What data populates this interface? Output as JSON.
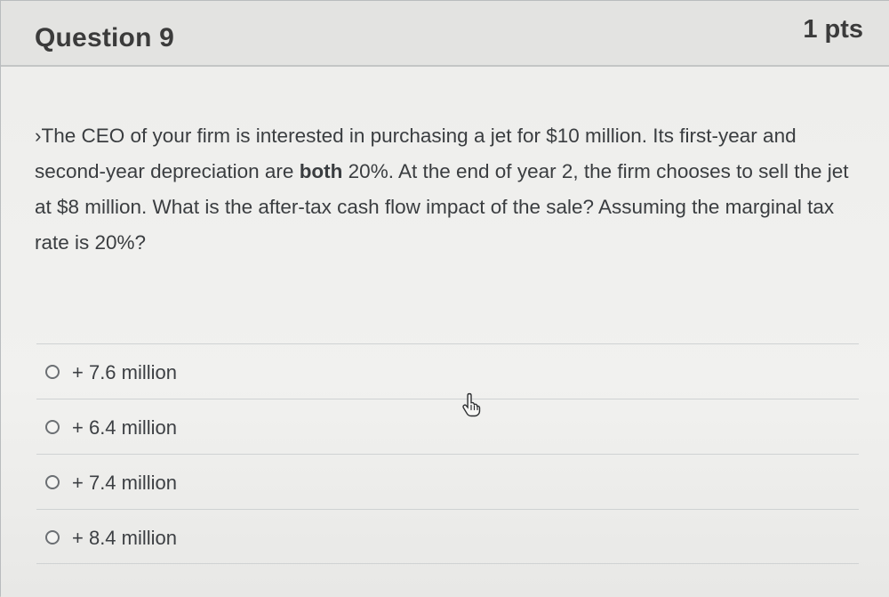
{
  "question": {
    "title": "Question 9",
    "points": "1 pts",
    "text_part1": "›The CEO of your firm is interested in purchasing a jet for $10 million. Its first-year and second-year depreciation are ",
    "text_emphasis": "both",
    "text_part2": " 20%. At the end of year 2, the firm chooses to sell the jet at $8 million. What is the after-tax cash flow impact of the sale? Assuming the marginal tax rate is 20%?"
  },
  "answers": [
    {
      "label": "+ 7.6 million"
    },
    {
      "label": "+ 6.4 million"
    },
    {
      "label": "+ 7.4 million"
    },
    {
      "label": "+ 8.4 million"
    }
  ],
  "icons": {
    "cursor": "hand-pointer-icon",
    "radio": "radio-button-icon"
  },
  "colors": {
    "header_background": "#e3e3e1",
    "body_background": "#eeeeec",
    "text": "#3a3d40",
    "divider": "#cfd2d3"
  }
}
